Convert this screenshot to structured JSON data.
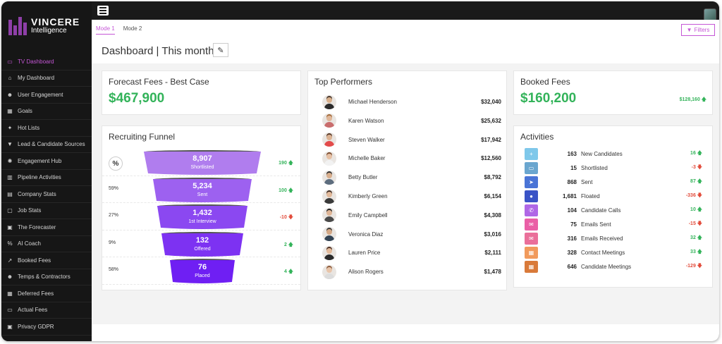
{
  "brand": {
    "line1": "VINCERE",
    "line2": "Intelligence",
    "color": "#8e3fa8"
  },
  "sidebar": {
    "items": [
      {
        "label": "TV Dashboard",
        "icon": "monitor-icon",
        "glyph": "▭",
        "active": true
      },
      {
        "label": "My Dashboard",
        "icon": "home-icon",
        "glyph": "⌂"
      },
      {
        "label": "User Engagement",
        "icon": "users-icon",
        "glyph": "☻"
      },
      {
        "label": "Goals",
        "icon": "calculator-icon",
        "glyph": "▦"
      },
      {
        "label": "Hot Lists",
        "icon": "fire-icon",
        "glyph": "✦"
      },
      {
        "label": "Lead & Candidate Sources",
        "icon": "funnel-icon",
        "glyph": "▼"
      },
      {
        "label": "Engagement Hub",
        "icon": "hub-icon",
        "glyph": "✺"
      },
      {
        "label": "Pipeline Activities",
        "icon": "bar-chart-icon",
        "glyph": "▥"
      },
      {
        "label": "Company Stats",
        "icon": "building-icon",
        "glyph": "▤"
      },
      {
        "label": "Job Stats",
        "icon": "clipboard-icon",
        "glyph": "▢"
      },
      {
        "label": "The Forecaster",
        "icon": "forecast-icon",
        "glyph": "▣"
      },
      {
        "label": "AI Coach",
        "icon": "percent-icon",
        "glyph": "%"
      },
      {
        "label": "Booked Fees",
        "icon": "trend-icon",
        "glyph": "↗"
      },
      {
        "label": "Temps & Contractors",
        "icon": "people-icon",
        "glyph": "☻"
      },
      {
        "label": "Deferred Fees",
        "icon": "calendar-icon",
        "glyph": "▦"
      },
      {
        "label": "Actual Fees",
        "icon": "receipt-icon",
        "glyph": "▭"
      },
      {
        "label": "Privacy GDPR",
        "icon": "privacy-icon",
        "glyph": "▣"
      }
    ]
  },
  "header": {
    "modes": [
      {
        "label": "Mode 1",
        "active": true
      },
      {
        "label": "Mode 2",
        "active": false
      }
    ],
    "title": "Dashboard | This month",
    "filters_label": "Filters"
  },
  "forecast": {
    "title": "Forecast Fees - Best Case",
    "value": "$467,900"
  },
  "booked": {
    "title": "Booked Fees",
    "value": "$160,200",
    "sub_value": "$128,160",
    "sub_trend": "up"
  },
  "funnel": {
    "title": "Recruiting Funnel",
    "percent_icon": "%",
    "stages": [
      {
        "value": "8,907",
        "label": "Shortlisted",
        "pct": "",
        "delta": "190",
        "trend": "up",
        "color": "#b07dee"
      },
      {
        "value": "5,234",
        "label": "Sent",
        "pct": "59%",
        "delta": "100",
        "trend": "up",
        "color": "#9d61f0"
      },
      {
        "value": "1,432",
        "label": "1st Interview",
        "pct": "27%",
        "delta": "-10",
        "trend": "down",
        "color": "#8b48f1"
      },
      {
        "value": "132",
        "label": "Offered",
        "pct": "9%",
        "delta": "2",
        "trend": "up",
        "color": "#7d32f2"
      },
      {
        "value": "76",
        "label": "Placed",
        "pct": "58%",
        "delta": "4",
        "trend": "up",
        "color": "#6f1ff3"
      }
    ]
  },
  "top_performers": {
    "title": "Top Performers",
    "rows": [
      {
        "name": "Michael Henderson",
        "amount": "$32,040",
        "skin": "#d9b08c",
        "hair": "#4a3a2f",
        "shirt": "#2b2b2b"
      },
      {
        "name": "Karen Watson",
        "amount": "$25,632",
        "skin": "#e0b89a",
        "hair": "#a36a3a",
        "shirt": "#c96d6d"
      },
      {
        "name": "Steven Walker",
        "amount": "$17,942",
        "skin": "#dcb394",
        "hair": "#5a3b29",
        "shirt": "#e34b4b"
      },
      {
        "name": "Michelle Baker",
        "amount": "$12,560",
        "skin": "#e6c0a4",
        "hair": "#7a4b2e",
        "shirt": "#f2f2f2"
      },
      {
        "name": "Betty Butler",
        "amount": "$8,792",
        "skin": "#d8ae8c",
        "hair": "#2f2f2f",
        "shirt": "#5d6d7e"
      },
      {
        "name": "Kimberly Green",
        "amount": "$6,154",
        "skin": "#e2b99a",
        "hair": "#3d2a20",
        "shirt": "#3a3a3a"
      },
      {
        "name": "Emily Campbell",
        "amount": "$4,308",
        "skin": "#dfb596",
        "hair": "#1f1f1f",
        "shirt": "#4a4a4a"
      },
      {
        "name": "Veronica Diaz",
        "amount": "$3,016",
        "skin": "#d4a886",
        "hair": "#3b3b3b",
        "shirt": "#345"
      },
      {
        "name": "Lauren Price",
        "amount": "$2,111",
        "skin": "#e3bb9c",
        "hair": "#4e2f22",
        "shirt": "#2a2a2a"
      },
      {
        "name": "Alison Rogers",
        "amount": "$1,478",
        "skin": "#e8c5aa",
        "hair": "#8c5a3a",
        "shirt": "#dcdcdc"
      }
    ]
  },
  "activities": {
    "title": "Activities",
    "rows": [
      {
        "count": "163",
        "label": "New Candidates",
        "delta": "16",
        "trend": "up",
        "icon": "user-plus-icon",
        "glyph": "+",
        "color": "#7fc8ea"
      },
      {
        "count": "15",
        "label": "Shortlisted",
        "delta": "-3",
        "trend": "down",
        "icon": "id-card-icon",
        "glyph": "▭",
        "color": "#6aa6cf"
      },
      {
        "count": "868",
        "label": "Sent",
        "delta": "87",
        "trend": "up",
        "icon": "paper-plane-icon",
        "glyph": "➤",
        "color": "#4a74d6"
      },
      {
        "count": "1,681",
        "label": "Floated",
        "delta": "-336",
        "trend": "down",
        "icon": "user-circle-icon",
        "glyph": "●",
        "color": "#3a53c6"
      },
      {
        "count": "104",
        "label": "Candidate Calls",
        "delta": "10",
        "trend": "up",
        "icon": "phone-icon",
        "glyph": "✆",
        "color": "#b067e6"
      },
      {
        "count": "75",
        "label": "Emails Sent",
        "delta": "-15",
        "trend": "down",
        "icon": "envelope-icon",
        "glyph": "✉",
        "color": "#ea5fa6"
      },
      {
        "count": "316",
        "label": "Emails Received",
        "delta": "32",
        "trend": "up",
        "icon": "envelope-open-icon",
        "glyph": "✉",
        "color": "#ea6f9a"
      },
      {
        "count": "328",
        "label": "Contact Meetings",
        "delta": "33",
        "trend": "up",
        "icon": "calendar-icon",
        "glyph": "▦",
        "color": "#f19a5c"
      },
      {
        "count": "646",
        "label": "Candidate Meetings",
        "delta": "-129",
        "trend": "down",
        "icon": "calendar-check-icon",
        "glyph": "▦",
        "color": "#d97a3a"
      }
    ]
  },
  "colors": {
    "accent": "#c556d6",
    "positive": "#33b35a",
    "negative": "#e24b3b"
  }
}
